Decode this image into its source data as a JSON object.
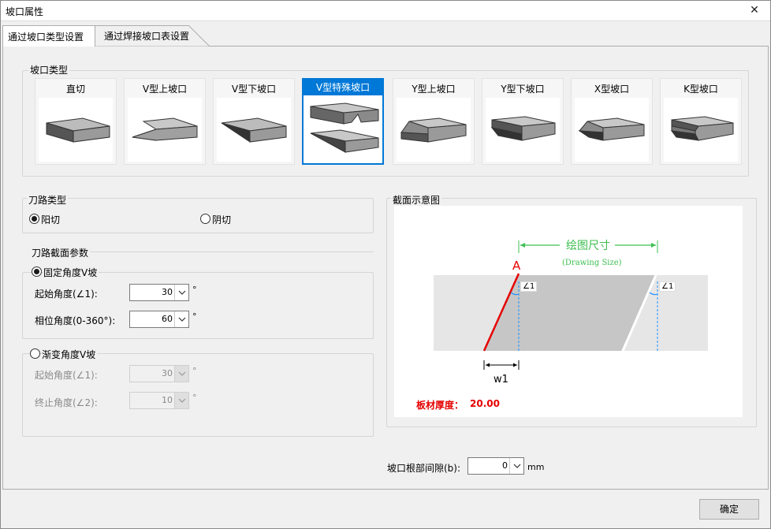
{
  "window": {
    "title": "坡口属性",
    "close_glyph": "✕"
  },
  "tabs": [
    {
      "label": "通过坡口类型设置",
      "active": true
    },
    {
      "label": "通过焊接坡口表设置",
      "active": false
    }
  ],
  "bevel_types": {
    "group_title": "坡口类型",
    "items": [
      {
        "label": "直切"
      },
      {
        "label": "V型上坡口"
      },
      {
        "label": "V型下坡口"
      },
      {
        "label": "V型特殊坡口",
        "selected": true
      },
      {
        "label": "Y型上坡口"
      },
      {
        "label": "Y型下坡口"
      },
      {
        "label": "X型坡口"
      },
      {
        "label": "K型坡口"
      }
    ]
  },
  "toolpath_type": {
    "group_title": "刀路类型",
    "options": [
      {
        "label": "阳切",
        "checked": true
      },
      {
        "label": "阴切",
        "checked": false
      }
    ]
  },
  "section_params": {
    "group_title": "刀路截面参数",
    "fixed": {
      "label": "固定角度V坡",
      "checked": true,
      "start_angle_label": "起始角度(∠1):",
      "start_angle_value": "30",
      "phase_angle_label": "相位角度(0-360°):",
      "phase_angle_value": "60",
      "unit": "°"
    },
    "gradual": {
      "label": "渐变角度V坡",
      "checked": false,
      "start_angle_label": "起始角度(∠1):",
      "start_angle_value": "30",
      "end_angle_label": "终止角度(∠2):",
      "end_angle_value": "10",
      "unit": "°"
    }
  },
  "diagram": {
    "group_title": "截面示意图",
    "draw_size_label": "绘图尺寸",
    "draw_size_sub": "(Drawing Size)",
    "point_label": "A",
    "angle_label": "∠1",
    "w_label": "w1",
    "thickness_label": "板材厚度：",
    "thickness_value": "20.00",
    "colors": {
      "red": "#e60000",
      "green": "#3cbf50",
      "blue": "#1e90ff"
    }
  },
  "root_gap": {
    "label": "坡口根部间隙(b):",
    "value": "0",
    "unit": "mm"
  },
  "ok_button": "确定"
}
